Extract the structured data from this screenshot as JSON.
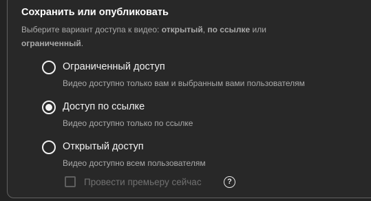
{
  "section": {
    "title": "Сохранить или опубликовать",
    "description_prefix": "Выберите вариант доступа к видео: ",
    "opt_public": "открытый",
    "sep1": ", ",
    "opt_link": "по ссылке",
    "sep2": " или ",
    "opt_restricted": "ограниченный",
    "suffix": "."
  },
  "options": [
    {
      "label": "Ограниченный доступ",
      "sub": "Видео доступно только вам и выбранным вами пользователям",
      "selected": false
    },
    {
      "label": "Доступ по ссылке",
      "sub": "Видео доступно только по ссылке",
      "selected": true
    },
    {
      "label": "Открытый доступ",
      "sub": "Видео доступно всем пользователям",
      "selected": false
    }
  ],
  "premiere": {
    "label": "Провести премьеру сейчас",
    "checked": false,
    "disabled": true,
    "help_icon": "help-circle-icon",
    "help_glyph": "?"
  }
}
